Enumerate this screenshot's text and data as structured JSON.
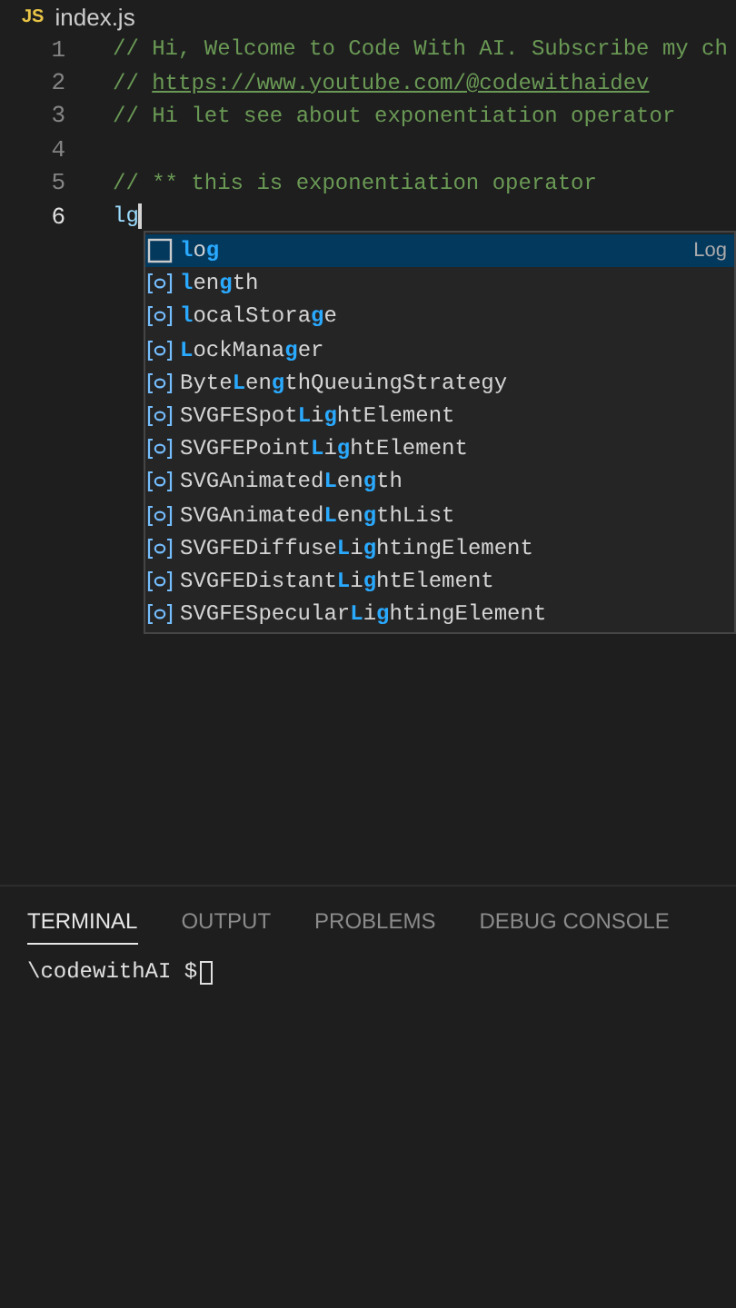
{
  "editor_tab": {
    "icon_text": "JS",
    "title": "index.js"
  },
  "lines": [
    {
      "number": "1",
      "kind": "comment",
      "text": "// Hi, Welcome to Code With AI. Subscribe my ch",
      "current": false
    },
    {
      "number": "2",
      "kind": "link",
      "prefix": "// ",
      "text": "https://www.youtube.com/@codewithaidev",
      "current": false
    },
    {
      "number": "3",
      "kind": "comment",
      "text": "// Hi let see about exponentiation operator",
      "current": false
    },
    {
      "number": "4",
      "kind": "blank",
      "current": false
    },
    {
      "number": "5",
      "kind": "comment",
      "text": "// ** this is exponentiation operator",
      "current": false
    },
    {
      "number": "6",
      "kind": "code",
      "text": "lg",
      "current": true
    }
  ],
  "suggestions": [
    {
      "selected": true,
      "kind": "text",
      "detail": "Log",
      "parts": [
        {
          "text": "l",
          "match": true
        },
        {
          "text": "o",
          "match": false
        },
        {
          "text": "g",
          "match": true
        }
      ]
    },
    {
      "selected": false,
      "kind": "variable",
      "parts": [
        {
          "text": "l",
          "match": true
        },
        {
          "text": "en",
          "match": false
        },
        {
          "text": "g",
          "match": true
        },
        {
          "text": "th",
          "match": false
        }
      ]
    },
    {
      "selected": false,
      "kind": "variable",
      "parts": [
        {
          "text": "l",
          "match": true
        },
        {
          "text": "ocalStora",
          "match": false
        },
        {
          "text": "g",
          "match": true
        },
        {
          "text": "e",
          "match": false
        }
      ]
    },
    {
      "selected": false,
      "kind": "variable",
      "parts": [
        {
          "text": "L",
          "match": true
        },
        {
          "text": "ockMana",
          "match": false
        },
        {
          "text": "g",
          "match": true
        },
        {
          "text": "er",
          "match": false
        }
      ]
    },
    {
      "selected": false,
      "kind": "variable",
      "parts": [
        {
          "text": "Byte",
          "match": false
        },
        {
          "text": "L",
          "match": true
        },
        {
          "text": "en",
          "match": false
        },
        {
          "text": "g",
          "match": true
        },
        {
          "text": "thQueuingStrategy",
          "match": false
        }
      ]
    },
    {
      "selected": false,
      "kind": "variable",
      "parts": [
        {
          "text": "SVGFESpot",
          "match": false
        },
        {
          "text": "L",
          "match": true
        },
        {
          "text": "i",
          "match": false
        },
        {
          "text": "g",
          "match": true
        },
        {
          "text": "htElement",
          "match": false
        }
      ]
    },
    {
      "selected": false,
      "kind": "variable",
      "parts": [
        {
          "text": "SVGFEPoint",
          "match": false
        },
        {
          "text": "L",
          "match": true
        },
        {
          "text": "i",
          "match": false
        },
        {
          "text": "g",
          "match": true
        },
        {
          "text": "htElement",
          "match": false
        }
      ]
    },
    {
      "selected": false,
      "kind": "variable",
      "parts": [
        {
          "text": "SVGAnimated",
          "match": false
        },
        {
          "text": "L",
          "match": true
        },
        {
          "text": "en",
          "match": false
        },
        {
          "text": "g",
          "match": true
        },
        {
          "text": "th",
          "match": false
        }
      ]
    },
    {
      "selected": false,
      "kind": "variable",
      "parts": [
        {
          "text": "SVGAnimated",
          "match": false
        },
        {
          "text": "L",
          "match": true
        },
        {
          "text": "en",
          "match": false
        },
        {
          "text": "g",
          "match": true
        },
        {
          "text": "thList",
          "match": false
        }
      ]
    },
    {
      "selected": false,
      "kind": "variable",
      "parts": [
        {
          "text": "SVGFEDiffuse",
          "match": false
        },
        {
          "text": "L",
          "match": true
        },
        {
          "text": "i",
          "match": false
        },
        {
          "text": "g",
          "match": true
        },
        {
          "text": "htingElement",
          "match": false
        }
      ]
    },
    {
      "selected": false,
      "kind": "variable",
      "parts": [
        {
          "text": "SVGFEDistant",
          "match": false
        },
        {
          "text": "L",
          "match": true
        },
        {
          "text": "i",
          "match": false
        },
        {
          "text": "g",
          "match": true
        },
        {
          "text": "htElement",
          "match": false
        }
      ]
    },
    {
      "selected": false,
      "kind": "variable",
      "parts": [
        {
          "text": "SVGFESpecular",
          "match": false
        },
        {
          "text": "L",
          "match": true
        },
        {
          "text": "i",
          "match": false
        },
        {
          "text": "g",
          "match": true
        },
        {
          "text": "htingElement",
          "match": false
        }
      ]
    }
  ],
  "panel_tabs": [
    {
      "label": "TERMINAL",
      "selected": true
    },
    {
      "label": "OUTPUT",
      "selected": false
    },
    {
      "label": "PROBLEMS",
      "selected": false
    },
    {
      "label": "DEBUG CONSOLE",
      "selected": false
    }
  ],
  "terminal": {
    "prompt": "\\codewithAI $"
  }
}
